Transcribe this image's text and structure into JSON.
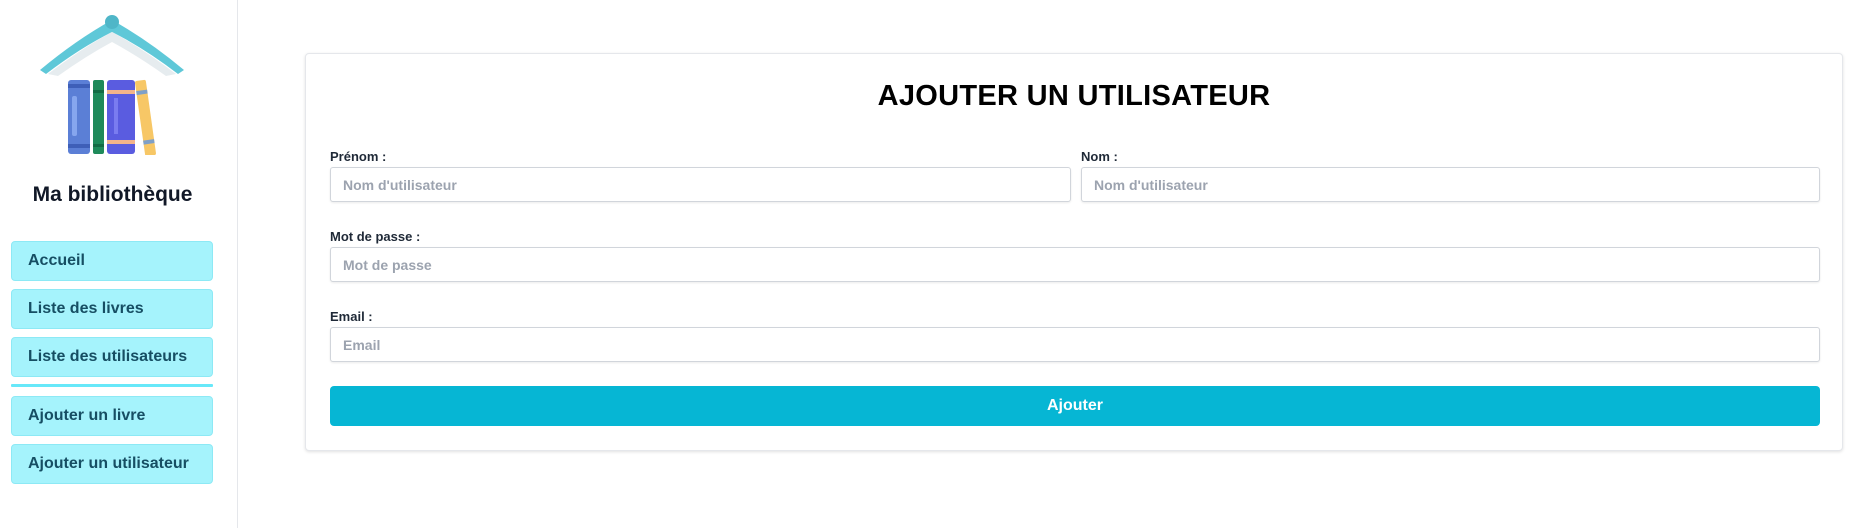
{
  "sidebar": {
    "brand": "Ma bibliothèque",
    "logo_icon": "book-stack-logo-icon",
    "items": [
      {
        "label": "Accueil"
      },
      {
        "label": "Liste des livres"
      },
      {
        "label": "Liste des utilisateurs"
      },
      {
        "label": "Ajouter un livre"
      },
      {
        "label": "Ajouter un utilisateur"
      }
    ]
  },
  "form": {
    "title": "AJOUTER UN UTILISATEUR",
    "fields": {
      "firstname": {
        "label": "Prénom :",
        "placeholder": "Nom d'utilisateur",
        "value": ""
      },
      "lastname": {
        "label": "Nom :",
        "placeholder": "Nom d'utilisateur",
        "value": ""
      },
      "password": {
        "label": "Mot de passe :",
        "placeholder": "Mot de passe",
        "value": ""
      },
      "email": {
        "label": "Email :",
        "placeholder": "Email",
        "value": ""
      }
    },
    "submit_label": "Ajouter"
  },
  "colors": {
    "nav_bg": "#a5f3fc",
    "nav_text": "#164e63",
    "accent": "#06b6d4"
  }
}
